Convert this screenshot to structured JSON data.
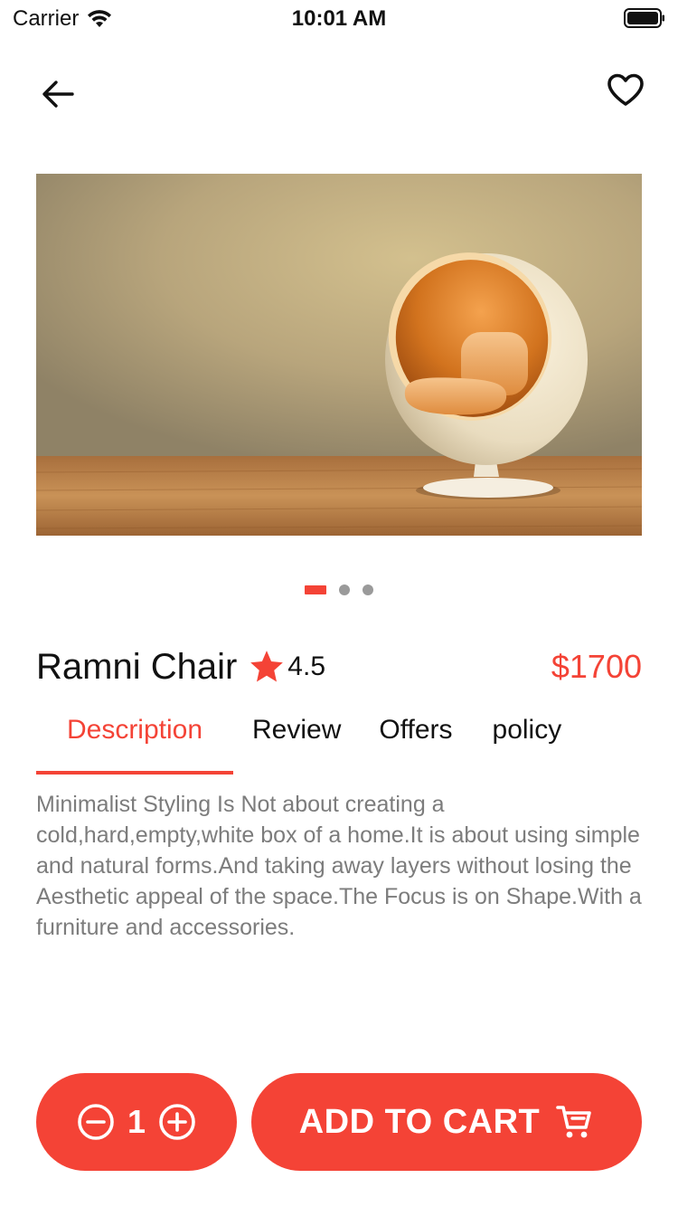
{
  "status_bar": {
    "carrier": "Carrier",
    "time": "10:01 AM"
  },
  "nav": {
    "back_icon": "arrow-left-icon",
    "favorite_icon": "heart-outline-icon"
  },
  "gallery": {
    "image_count": 3,
    "active_index": 0
  },
  "product": {
    "name": "Ramni Chair",
    "rating": "4.5",
    "price": "$1700"
  },
  "tabs": [
    {
      "label": "Description",
      "active": true
    },
    {
      "label": "Review",
      "active": false
    },
    {
      "label": "Offers",
      "active": false
    },
    {
      "label": "policy",
      "active": false
    }
  ],
  "description": "Minimalist Styling Is Not about creating a cold,hard,empty,white box of a home.It is about using simple and natural forms.And taking away layers without losing the Aesthetic appeal of the space.The Focus is on Shape.With a furniture and accessories.",
  "cart": {
    "quantity": "1",
    "add_label": "ADD TO CART"
  },
  "colors": {
    "accent": "#f44336",
    "text": "#111111",
    "muted": "#7c7c7c"
  }
}
